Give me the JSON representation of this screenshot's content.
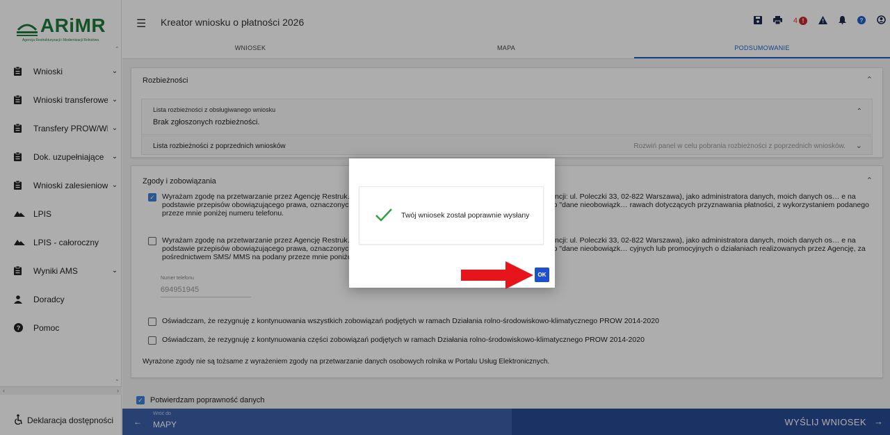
{
  "app": {
    "title": "Kreator wniosku o płatności 2026",
    "logo_text": "ARiMR",
    "logo_subtitle": "Agencja Restrukturyzacji i Modernizacji Rolnictwa"
  },
  "header_icons": [
    "save-icon",
    "print-icon",
    "alert-icon",
    "warning-icon",
    "bell-icon",
    "help-icon",
    "user-icon"
  ],
  "notifications": {
    "count": "4",
    "badge": "!"
  },
  "tabs": [
    {
      "label": "WNIOSEK",
      "active": false
    },
    {
      "label": "MAPA",
      "active": false
    },
    {
      "label": "PODSUMOWANIE",
      "active": true
    }
  ],
  "sidebar": {
    "items": [
      {
        "label": "Wnioski",
        "icon": "clipboard-icon",
        "chevron": "⌄"
      },
      {
        "label": "Wnioski transferowe",
        "icon": "clipboard-icon",
        "chevron": "⌄"
      },
      {
        "label": "Transfery PROW/WPR",
        "icon": "clipboard-icon",
        "chevron": "⌄"
      },
      {
        "label": "Dok. uzupełniające",
        "icon": "clipboard-icon",
        "chevron": "⌄"
      },
      {
        "label": "Wnioski zalesieniowe",
        "icon": "clipboard-icon",
        "chevron": "⌄"
      },
      {
        "label": "LPIS",
        "icon": "mountain-icon",
        "chevron": ""
      },
      {
        "label": "LPIS - całoroczny",
        "icon": "mountain-icon",
        "chevron": ""
      },
      {
        "label": "Wyniki AMS",
        "icon": "clipboard-icon",
        "chevron": "⌄"
      },
      {
        "label": "Doradcy",
        "icon": "person-icon",
        "chevron": ""
      },
      {
        "label": "Pomoc",
        "icon": "help-icon",
        "chevron": ""
      }
    ],
    "footer": "Deklaracja dostępności"
  },
  "discrepancies": {
    "title": "Rozbieżności",
    "current_title": "Lista rozbieżności z obsługiwanego wniosku",
    "current_value": "Brak zgłoszonych rozbieżności.",
    "previous_title": "Lista rozbieżności z poprzednich wniosków",
    "previous_hint": "Rozwiń panel w celu pobrania rozbieżności z poprzednich wniosków."
  },
  "consents": {
    "title": "Zgody i zobowiązania",
    "items": [
      {
        "checked": true,
        "text": "Wyrażam zgodę na przetwarzanie przez Agencję Restruk… Jana Pawła II nr 70, 00-175 Warszawa (adres do korespondencji: ul. Poleczki 33, 02-822 Warszawa), jako administratora danych, moich danych os… e na podstawie przepisów obowiązującego prawa, oznaczonych w formularzu wniosku o przyznanie płatności na rok 2026, jako \"dane nieobowiązk… rawach dotyczących przyznawania płatności, z wykorzystaniem podanego przeze mnie poniżej numeru telefonu."
      },
      {
        "checked": false,
        "text": "Wyrażam zgodę na przetwarzanie przez Agencję Restruk… Jana Pawła II nr 70, 00-175 Warszawa (adres do korespondencji: ul. Poleczki 33, 02-822 Warszawa), jako administratora danych, moich danych os… e na podstawie przepisów obowiązującego prawa, oznaczonych w formularzu wniosku o przyznanie płatności na rok 2026, jako \"dane nieobowiązk… cyjnych lub promocyjnych o działaniach realizowanych przez Agencję, za pośrednictwem SMS/ MMS na podany przeze mnie poniżej numer telefonu."
      },
      {
        "checked": false,
        "text": "Oświadczam, że rezygnuję z kontynuowania wszystkich zobowiązań podjętych w ramach Działania rolno-środowiskowo-klimatycznego PROW 2014-2020"
      },
      {
        "checked": false,
        "text": "Oświadczam, że rezygnuję z kontynuowania części zobowiązań podjętych w ramach Działania rolno-środowiskowo-klimatycznego PROW 2014-2020"
      }
    ],
    "phone_label": "Numer telefonu",
    "phone_value": "694951945",
    "note": "Wyrażone zgody nie są tożsame z wyrażeniem zgody na przetwarzanie danych osobowych rolnika w Portalu Usług Elektronicznych."
  },
  "confirm": {
    "checked": true,
    "label": "Potwierdzam poprawność danych"
  },
  "bottom": {
    "back_small": "Wróć do",
    "back_big": "MAPY",
    "send": "WYŚLIJ WNIOSEK"
  },
  "dialog": {
    "message": "Twój wniosek został poprawnie wysłany",
    "ok_label": "OK"
  },
  "colors": {
    "accent": "#1e62c9",
    "brand_green": "#1f7a3a",
    "bottom_back": "#3b5fa8",
    "bottom_send": "#284a94",
    "arrow": "#e8141b"
  }
}
